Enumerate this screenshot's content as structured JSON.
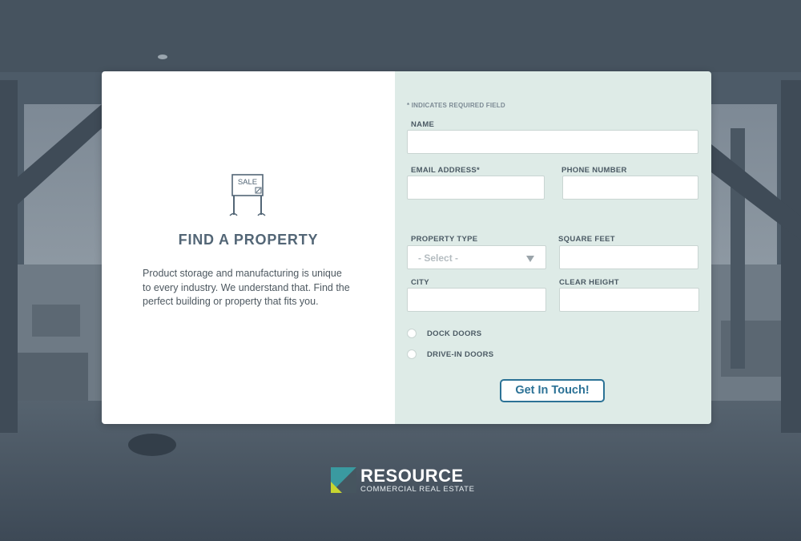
{
  "card": {
    "icon": "for-sale-sign-icon",
    "sign_text": "SALE",
    "title": "FIND A PROPERTY",
    "description": "Product storage and manufacturing is unique to every industry. We understand that. Find the perfect building or property that fits you."
  },
  "form": {
    "required_note": "* INDICATES REQUIRED FIELD",
    "name": {
      "label": "NAME",
      "value": "",
      "placeholder": ""
    },
    "email": {
      "label": "EMAIL ADDRESS*",
      "value": "",
      "placeholder": ""
    },
    "phone": {
      "label": "PHONE NUMBER",
      "value": "",
      "placeholder": ""
    },
    "property_type": {
      "label": "PROPERTY TYPE",
      "selected": "- Select -"
    },
    "square_feet": {
      "label": "SQUARE FEET",
      "value": "",
      "placeholder": ""
    },
    "city": {
      "label": "CITY",
      "value": "",
      "placeholder": ""
    },
    "clear_height": {
      "label": "CLEAR HEIGHT",
      "value": "",
      "placeholder": ""
    },
    "options": [
      {
        "label": "DOCK DOORS",
        "checked": false
      },
      {
        "label": "DRIVE-IN DOORS",
        "checked": false
      }
    ],
    "submit_label": "Get In Touch!"
  },
  "footer": {
    "logo_name": "RESOURCE",
    "logo_sub": "COMMERCIAL REAL ESTATE"
  },
  "colors": {
    "form_panel": "#deebe7",
    "button": "#2c7296",
    "logo_teal": "#3a9aa0",
    "logo_lime": "#c7d530"
  }
}
